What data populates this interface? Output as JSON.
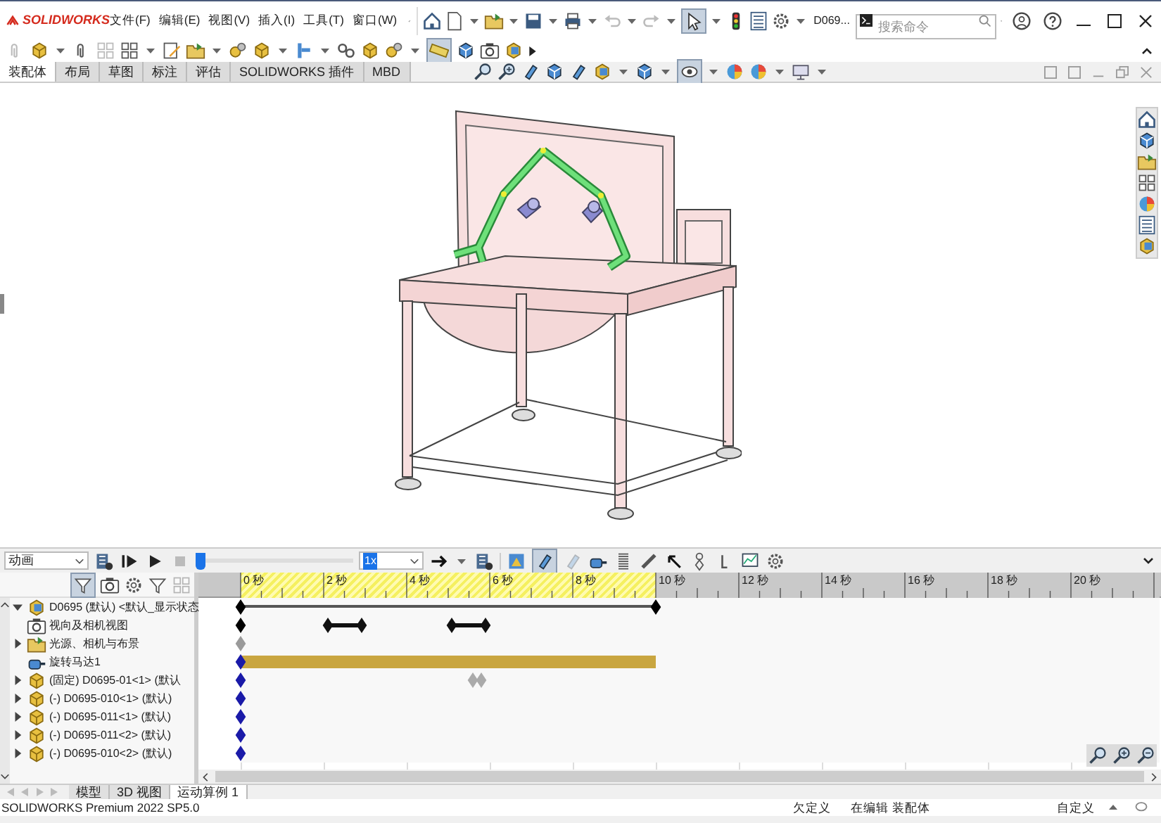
{
  "app": {
    "logo": "SOLIDWORKS",
    "menus": [
      "文件(F)",
      "编辑(E)",
      "视图(V)",
      "插入(I)",
      "工具(T)",
      "窗口(W)"
    ],
    "document": "D069...",
    "search": {
      "placeholder": "搜索命令"
    },
    "select_tool": {
      "on": true
    }
  },
  "command_manager": {
    "toggle_on": true,
    "tabs": [
      {
        "label": "装配体",
        "selected": true
      },
      {
        "label": "布局",
        "selected": false
      },
      {
        "label": "草图",
        "selected": false
      },
      {
        "label": "标注",
        "selected": false
      },
      {
        "label": "评估",
        "selected": false
      },
      {
        "label": "SOLIDWORKS 插件",
        "selected": false
      },
      {
        "label": "MBD",
        "selected": false
      }
    ]
  },
  "view_toolbar": {
    "display_style_on": true
  },
  "motion_study": {
    "study_type": "动画",
    "slider": {
      "level": 0
    },
    "speed": "1x",
    "autokey_on": true,
    "tree": [
      {
        "label": "D0695 (默认) <默认_显示状态",
        "expandable": true,
        "expanded": true,
        "track": {
          "kind": "span",
          "keys": [
            {
              "level": 0,
              "color": "#000000"
            },
            {
              "level": 0.4517,
              "color": "#000000"
            }
          ]
        }
      },
      {
        "label": "视向及相机视图",
        "expandable": false,
        "track": {
          "kind": "keys",
          "keys": [
            {
              "level": 0,
              "color": "#000000"
            }
          ],
          "markers": [
            {
              "kind": "dumbbell",
              "keys": [
                {
                  "level": 0.0949
                },
                {
                  "level": 0.131
                }
              ]
            },
            {
              "kind": "dumbbell",
              "keys": [
                {
                  "level": 0.2304
                },
                {
                  "level": 0.2665
                }
              ]
            }
          ]
        }
      },
      {
        "label": "光源、相机与布景",
        "expandable": true,
        "expanded": false,
        "track": {
          "kind": "keys",
          "keys": [
            {
              "level": 0,
              "color": "#9a9a9a"
            }
          ]
        }
      },
      {
        "label": "旋转马达1",
        "expandable": false,
        "track": {
          "kind": "bar",
          "color": "#c9a640",
          "keys": [
            {
              "level": 0,
              "color": "#1a1aa8"
            }
          ],
          "level": 0.4517
        }
      },
      {
        "label": "(固定) D0695-01<1> (默认",
        "expandable": true,
        "expanded": false,
        "track": {
          "kind": "keys",
          "keys": [
            {
              "level": 0,
              "color": "#1a1aa8"
            }
          ],
          "markers": [
            {
              "kind": "ghost",
              "keys": [
                {
                  "level": 0.2532
                },
                {
                  "level": 0.2624
                }
              ]
            }
          ]
        }
      },
      {
        "label": "(-) D0695-010<1> (默认)",
        "expandable": true,
        "expanded": false,
        "track": {
          "kind": "keys",
          "keys": [
            {
              "level": 0,
              "color": "#1a1aa8"
            }
          ]
        }
      },
      {
        "label": "(-) D0695-011<1> (默认)",
        "expandable": true,
        "expanded": false,
        "track": {
          "kind": "keys",
          "keys": [
            {
              "level": 0,
              "color": "#1a1aa8"
            }
          ]
        }
      },
      {
        "label": "(-) D0695-011<2> (默认)",
        "expandable": true,
        "expanded": false,
        "track": {
          "kind": "keys",
          "keys": [
            {
              "level": 0,
              "color": "#1a1aa8"
            }
          ]
        }
      },
      {
        "label": "(-) D0695-010<2> (默认)",
        "expandable": true,
        "expanded": false,
        "track": {
          "kind": "keys",
          "keys": [
            {
              "level": 0,
              "color": "#1a1aa8"
            }
          ]
        }
      }
    ],
    "timeline": {
      "labels": [
        "0 秒",
        "2 秒",
        "4 秒",
        "6 秒",
        "8 秒",
        "10 秒",
        "12 秒",
        "14 秒",
        "16 秒",
        "18 秒",
        "20 秒"
      ],
      "active_span": {
        "level": 0.4517
      }
    }
  },
  "bottom_tabs": [
    {
      "label": "模型",
      "selected": false
    },
    {
      "label": "3D 视图",
      "selected": false
    },
    {
      "label": "运动算例 1",
      "selected": true
    }
  ],
  "status_bar": {
    "product": "SOLIDWORKS Premium 2022 SP5.0",
    "state": "欠定义",
    "mode": "在编辑 装配体",
    "units": "自定义"
  }
}
